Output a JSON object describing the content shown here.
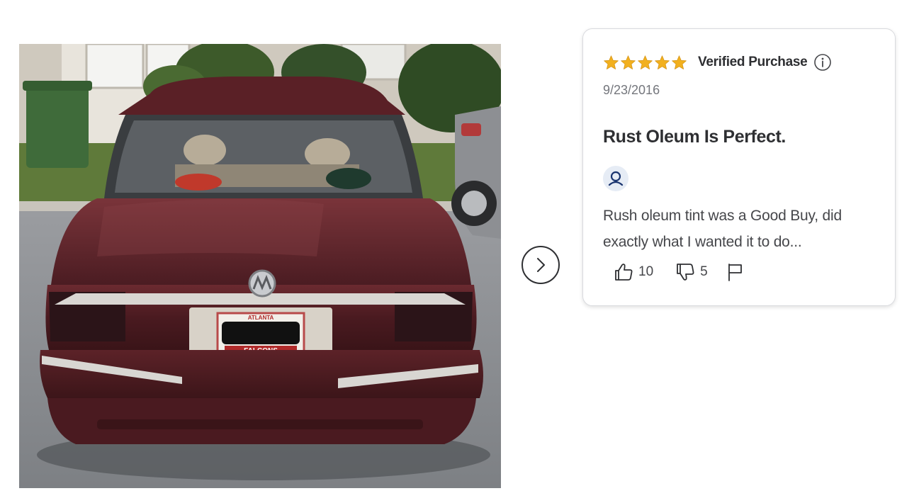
{
  "review": {
    "rating": 5,
    "rating_max": 5,
    "verified_label": "Verified Purchase",
    "date": "9/23/2016",
    "title": "Rust Oleum Is Perfect.",
    "body": "Rush oleum tint was a Good Buy, did exactly what I wanted it to do...",
    "helpful_count": "10",
    "unhelpful_count": "5"
  },
  "photo": {
    "plate_top": "ATLANTA",
    "plate_bottom": "FALCONS"
  },
  "icons": {
    "star": "star-icon",
    "info": "info-icon",
    "avatar": "user-avatar-icon",
    "thumbs_up": "thumbs-up-icon",
    "thumbs_down": "thumbs-down-icon",
    "flag": "flag-icon",
    "next": "chevron-right-icon"
  },
  "colors": {
    "star": "#f2b01e",
    "text": "#2e2f32",
    "muted": "#74767c",
    "avatar_bg": "#e6ecf5",
    "avatar_icon": "#1a3570"
  }
}
